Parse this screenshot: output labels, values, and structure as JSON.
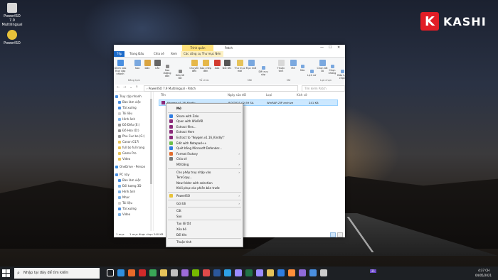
{
  "desktop": {
    "icons": [
      {
        "label": "PowerISO 7.9 Multilingual",
        "color": "#d9d9d9"
      },
      {
        "label": "PowerISO",
        "color": "#e8c23a"
      }
    ],
    "logo": {
      "letter": "K",
      "text": "KASHI"
    }
  },
  "window": {
    "title_context_tab": "Trình quản",
    "title": "Patch",
    "controls": [
      "—",
      "☐",
      "✕"
    ],
    "tabs": [
      "Tệp",
      "Trang Đầu",
      "Chia sẻ",
      "Xem",
      "Các công cụ Thư mục Nén"
    ],
    "ribbon": {
      "buttons": [
        {
          "label": "Ghim vào Truy cập nhanh",
          "icon": "pin-icon",
          "color": "#4a8fe0"
        },
        {
          "label": "Sao",
          "icon": "copy-icon",
          "color": "#7aa8df"
        },
        {
          "label": "Dán",
          "icon": "paste-icon",
          "color": "#d9a441"
        },
        {
          "label": "Cắt",
          "icon": "cut-icon",
          "color": "#666666"
        },
        {
          "label": "Sao đường dẫn",
          "icon": "copy-path-icon",
          "color": "#8a8a8a"
        },
        {
          "label": "Dán lối tắt",
          "icon": "paste-shortcut-icon",
          "color": "#8a8a8a"
        },
        {
          "label": "Chuyển đến",
          "icon": "move-icon",
          "color": "#e6b84a"
        },
        {
          "label": "Sao chép đến",
          "icon": "copy-to-icon",
          "color": "#e6b84a"
        },
        {
          "label": "Xóa",
          "icon": "delete-icon",
          "color": "#d23b2f"
        },
        {
          "label": "Đổi tên",
          "icon": "rename-icon",
          "color": "#555555"
        },
        {
          "label": "Thư mục mới",
          "icon": "new-folder-icon",
          "color": "#e6c35a"
        },
        {
          "label": "Mục mới",
          "icon": "new-item-icon",
          "color": "#7aa8df"
        },
        {
          "label": "Dễ truy cập",
          "icon": "easy-access-icon",
          "color": "#7aa8df"
        },
        {
          "label": "Thuộc tính",
          "icon": "properties-icon",
          "color": "#d9d9d9"
        },
        {
          "label": "Mở",
          "icon": "open-icon",
          "color": "#7aa8df"
        },
        {
          "label": "Sửa",
          "icon": "edit-icon",
          "color": "#7aa8df"
        },
        {
          "label": "Lịch sử",
          "icon": "history-icon",
          "color": "#7aa8df"
        },
        {
          "label": "Chọn tất cả",
          "icon": "select-all-icon",
          "color": "#7aa8df"
        },
        {
          "label": "Chọn không",
          "icon": "select-none-icon",
          "color": "#7aa8df"
        },
        {
          "label": "Đảo lựa chọn",
          "icon": "invert-selection-icon",
          "color": "#7aa8df"
        }
      ],
      "groups": [
        "Bảng tạm",
        "Tổ chức",
        "Mới",
        "Mở",
        "Lựa chọn"
      ]
    },
    "address": {
      "nav": [
        "←",
        "→",
        "⌄",
        "↑"
      ],
      "path": "›  PowerISO 7.9 Multilingual  ›  Patch",
      "search_placeholder": "Tìm kiếm Patch"
    },
    "nav_items": [
      {
        "label": "Truy cập nhanh",
        "color": "#4a8fe0"
      },
      {
        "label": "Bàn làm việc",
        "color": "#4a8fe0"
      },
      {
        "label": "Tải xuống",
        "color": "#4a8fe0"
      },
      {
        "label": "Tài liệu",
        "color": "#cfcfcf"
      },
      {
        "label": "Hình ảnh",
        "color": "#7fb3e6"
      },
      {
        "label": "Đồ Điều (E:)",
        "color": "#999999"
      },
      {
        "label": "Đồ Hoa (D:)",
        "color": "#999999"
      },
      {
        "label": "Phu Cuc bo (G:)",
        "color": "#999999"
      },
      {
        "label": "Canon G17i",
        "color": "#e6c35a"
      },
      {
        "label": "full bo full nang",
        "color": "#e6c35a"
      },
      {
        "label": "Game Pro",
        "color": "#e6c35a"
      },
      {
        "label": "Video",
        "color": "#e6c35a"
      },
      {
        "label": "OneDrive - Person",
        "color": "#3c8fe0"
      },
      {
        "label": "PC này",
        "color": "#4a8fe0"
      },
      {
        "label": "Bàn làm việc",
        "color": "#4a8fe0"
      },
      {
        "label": "Đối tượng 3D",
        "color": "#7fb3e6"
      },
      {
        "label": "Hình ảnh",
        "color": "#7fb3e6"
      },
      {
        "label": "Nhạc",
        "color": "#7fb3e6"
      },
      {
        "label": "Tài liệu",
        "color": "#cfcfcf"
      },
      {
        "label": "Tải xuống",
        "color": "#4a8fe0"
      },
      {
        "label": "Video",
        "color": "#7fb3e6"
      }
    ],
    "columns": [
      "Tên",
      "Ngày sửa đổi",
      "Loại",
      "Kích cỡ"
    ],
    "file": {
      "name": "Keygen.v1.16_Kindly",
      "date": "8/2/2021 02:59 SA",
      "type": "WinRAR ZIP archive",
      "size": "241 KB"
    },
    "status": {
      "count": "1 mục",
      "selected": "1 mục được chọn  240 KB"
    }
  },
  "context_menu": [
    {
      "label": "Mở",
      "icon": "",
      "arrow": false,
      "bold": true
    },
    {
      "label": "Share with Zalo",
      "icon": "#2f7de1",
      "arrow": false
    },
    {
      "label": "Open with WinRAR",
      "icon": "#8b2a7a",
      "arrow": false
    },
    {
      "label": "Extract files...",
      "icon": "#8b2a7a",
      "arrow": false
    },
    {
      "label": "Extract Here",
      "icon": "#8b2a7a",
      "arrow": false
    },
    {
      "label": "Extract to \"Keygen.v1.16_Kindly\\\"",
      "icon": "#8b2a7a",
      "arrow": false
    },
    {
      "label": "Edit with Notepad++",
      "icon": "#6cbf4a",
      "arrow": false
    },
    {
      "label": "Quét bằng Microsoft Defender...",
      "icon": "#2f7de1",
      "arrow": false
    },
    {
      "label": "Format Factory",
      "icon": "#e36c2c",
      "arrow": true
    },
    {
      "label": "Chia sẻ",
      "icon": "#777777",
      "arrow": false
    },
    {
      "label": "Mở bằng",
      "icon": "",
      "arrow": true
    },
    {
      "label": "Cho phép truy nhập vào",
      "icon": "",
      "arrow": true
    },
    {
      "label": "TeraCopy...",
      "icon": "",
      "arrow": false
    },
    {
      "label": "New folder with selection",
      "icon": "",
      "arrow": false
    },
    {
      "label": "Khôi phục các phiên bản trước",
      "icon": "",
      "arrow": false
    },
    {
      "label": "PowerISO",
      "icon": "#e8c23a",
      "arrow": true
    },
    {
      "label": "Gửi tới",
      "icon": "",
      "arrow": true
    },
    {
      "label": "Cắt",
      "icon": "",
      "arrow": false
    },
    {
      "label": "Sao",
      "icon": "",
      "arrow": false
    },
    {
      "label": "Tạo lối tắt",
      "icon": "",
      "arrow": false
    },
    {
      "label": "Xóa bỏ",
      "icon": "",
      "arrow": false
    },
    {
      "label": "Đổi tên",
      "icon": "",
      "arrow": false
    },
    {
      "label": "Thuộc tính",
      "icon": "",
      "arrow": false
    }
  ],
  "taskbar": {
    "search_placeholder": "Nhập tại đây để tìm kiếm",
    "apps": [
      {
        "name": "task-view-icon",
        "color": "#ffffff"
      },
      {
        "name": "edge-icon",
        "color": "#2f8fe0"
      },
      {
        "name": "firefox-icon",
        "color": "#e86a2a"
      },
      {
        "name": "opera-icon",
        "color": "#d12a2a"
      },
      {
        "name": "chrome-icon",
        "color": "#3aa757"
      },
      {
        "name": "explorer-icon",
        "color": "#e6c35a"
      },
      {
        "name": "game-icon",
        "color": "#c0c0c0"
      },
      {
        "name": "app-icon",
        "color": "#9c6ad9"
      },
      {
        "name": "nvidia-icon",
        "color": "#76b900"
      },
      {
        "name": "media-icon",
        "color": "#e04a4a"
      },
      {
        "name": "word-icon",
        "color": "#2b579a"
      },
      {
        "name": "photoshop-icon",
        "color": "#2ea0e6"
      },
      {
        "name": "ae-icon",
        "color": "#9c8cff"
      },
      {
        "name": "excel-icon",
        "color": "#217346"
      },
      {
        "name": "premiere-icon",
        "color": "#9c8cff"
      },
      {
        "name": "explorer-icon-2",
        "color": "#e6c35a"
      },
      {
        "name": "zalo-icon",
        "color": "#2f7de1"
      },
      {
        "name": "app-icon-2",
        "color": "#ff8f3a"
      },
      {
        "name": "app-icon-3",
        "color": "#8f6ad9"
      },
      {
        "name": "app-icon-4",
        "color": "#4a8fe0"
      },
      {
        "name": "app-icon-5",
        "color": "#cccccc"
      }
    ],
    "badge": "21",
    "time": "4:37 CH",
    "date": "04/05/2021"
  }
}
